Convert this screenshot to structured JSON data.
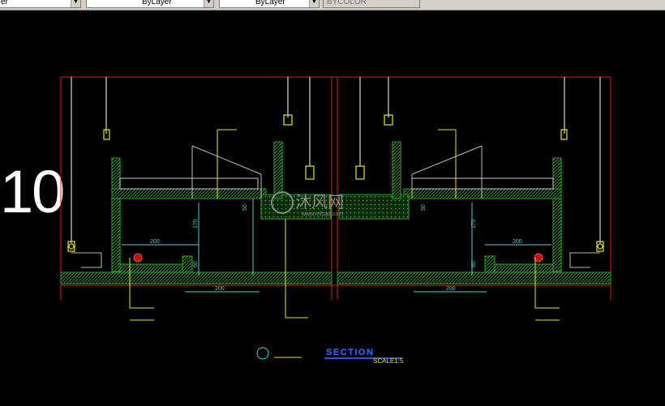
{
  "toolbar": {
    "layer_value": "er",
    "color_value": "ByLayer",
    "linetype_value": "ByLayer",
    "plotstyle_value": "BYCOLOR"
  },
  "drawing": {
    "sheet_number": "10",
    "section_title": "SECTION",
    "scale_label": "SCALE1:5",
    "detail_tag": "",
    "detail_caption": "",
    "dim_labels": [
      "200",
      "200",
      "200",
      "200",
      "170",
      "170",
      "50",
      "50",
      "60",
      "60"
    ],
    "watermark_text": "沐风网",
    "watermark_url": "www.mfcad.com",
    "colors": {
      "background": "#000000",
      "wall_red": "#e41b1b",
      "hatch_green": "#1eaa1e",
      "dim_cyan": "#4ad0c8",
      "note_yellow": "#e8e800",
      "line_white": "#ffffff",
      "blue_title": "#2255ee"
    }
  }
}
